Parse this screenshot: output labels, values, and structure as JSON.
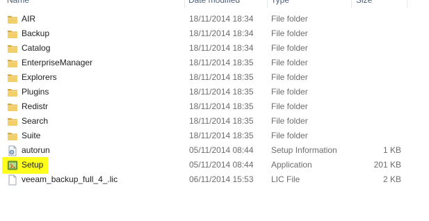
{
  "columns": {
    "name": "Name",
    "date": "Date modified",
    "type": "Type",
    "size": "Size"
  },
  "files": [
    {
      "name": "AIR",
      "date": "18/11/2014 18:34",
      "type": "File folder",
      "size": "",
      "icon": "folder-icon"
    },
    {
      "name": "Backup",
      "date": "18/11/2014 18:34",
      "type": "File folder",
      "size": "",
      "icon": "folder-icon"
    },
    {
      "name": "Catalog",
      "date": "18/11/2014 18:34",
      "type": "File folder",
      "size": "",
      "icon": "folder-icon"
    },
    {
      "name": "EnterpriseManager",
      "date": "18/11/2014 18:35",
      "type": "File folder",
      "size": "",
      "icon": "folder-icon"
    },
    {
      "name": "Explorers",
      "date": "18/11/2014 18:35",
      "type": "File folder",
      "size": "",
      "icon": "folder-icon"
    },
    {
      "name": "Plugins",
      "date": "18/11/2014 18:35",
      "type": "File folder",
      "size": "",
      "icon": "folder-icon"
    },
    {
      "name": "Redistr",
      "date": "18/11/2014 18:35",
      "type": "File folder",
      "size": "",
      "icon": "folder-icon"
    },
    {
      "name": "Search",
      "date": "18/11/2014 18:35",
      "type": "File folder",
      "size": "",
      "icon": "folder-icon"
    },
    {
      "name": "Suite",
      "date": "18/11/2014 18:35",
      "type": "File folder",
      "size": "",
      "icon": "folder-icon"
    },
    {
      "name": "autorun",
      "date": "05/11/2014 08:44",
      "type": "Setup Information",
      "size": "1 KB",
      "icon": "settings-file-icon"
    },
    {
      "name": "Setup",
      "date": "05/11/2014 08:44",
      "type": "Application",
      "size": "201 KB",
      "icon": "installer-icon"
    },
    {
      "name": "veeam_backup_full_4_.lic",
      "date": "06/11/2014 15:53",
      "type": "LIC File",
      "size": "2 KB",
      "icon": "document-icon"
    }
  ],
  "colors": {
    "highlight": "#ffff1c",
    "folder": "#e8c05a",
    "header_text": "#4c607a",
    "secondary_text": "#6d6d6d"
  }
}
